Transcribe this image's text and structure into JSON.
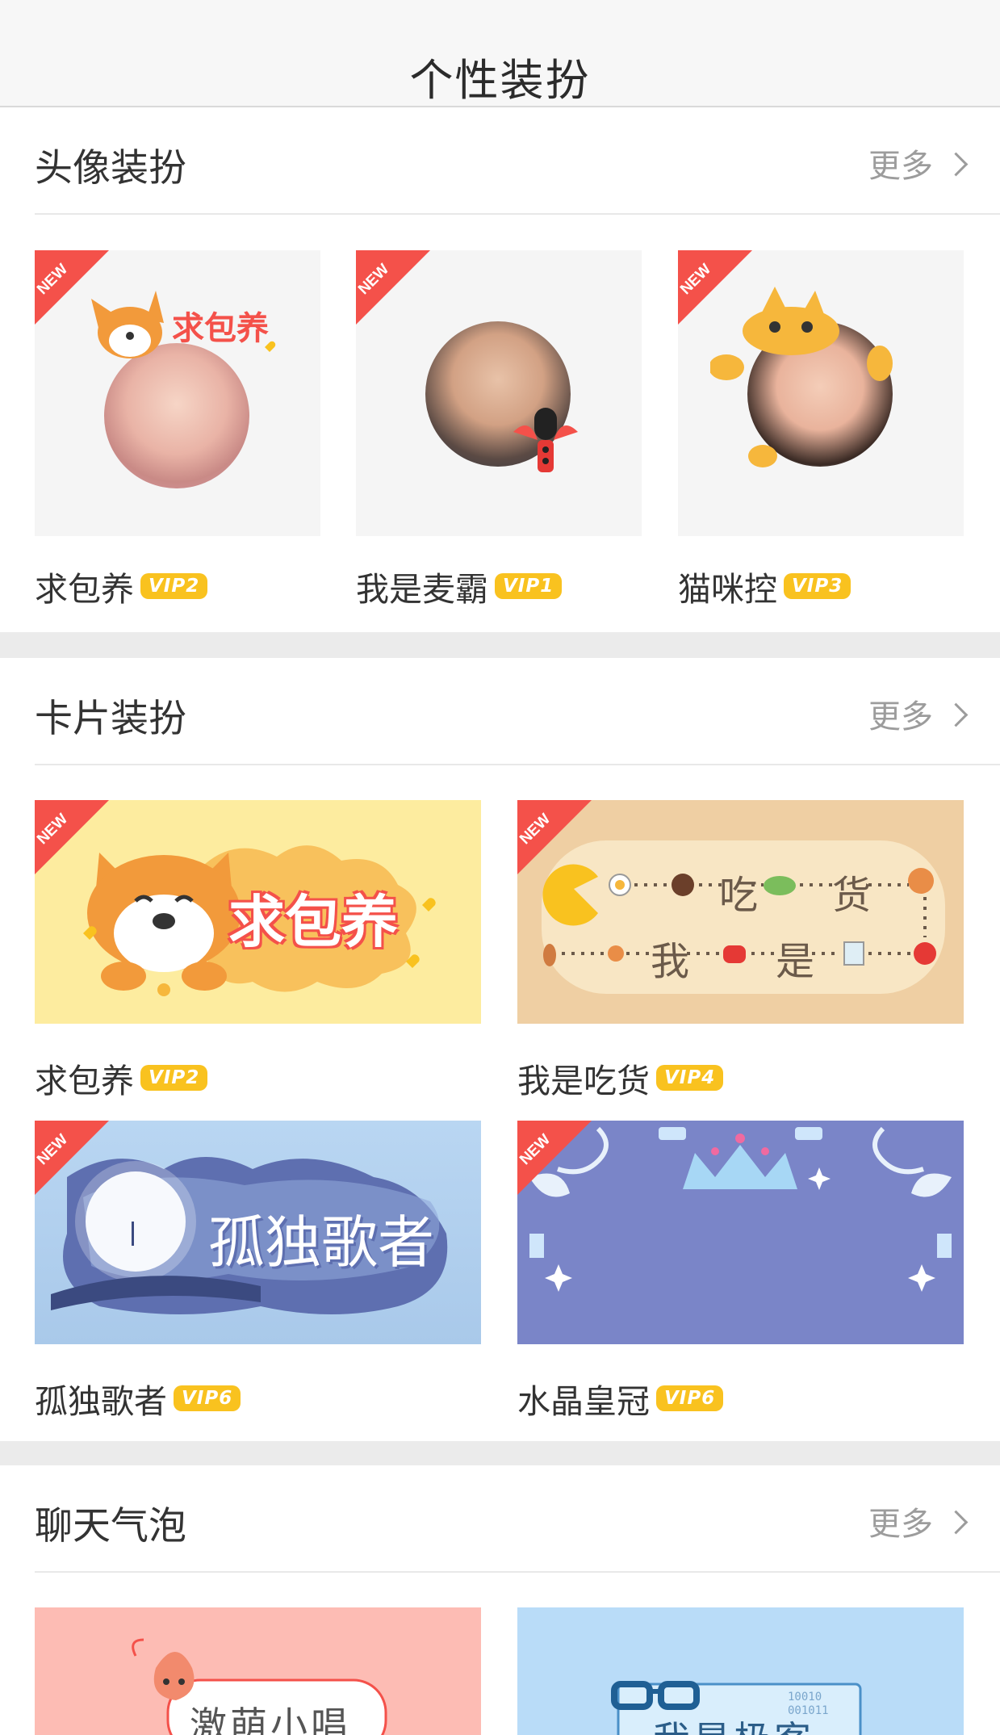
{
  "nav": {
    "title": "个性装扮"
  },
  "more_label": "更多",
  "new_badge": "NEW",
  "colors": {
    "vip": "#f9c21f",
    "new_red": "#f4514a",
    "accent": "#f29a3b"
  },
  "avatar_section": {
    "title": "头像装扮",
    "items": [
      {
        "name": "求包养",
        "vip": "VIP2",
        "overlay_text": "求包养"
      },
      {
        "name": "我是麦霸",
        "vip": "VIP1"
      },
      {
        "name": "猫咪控",
        "vip": "VIP3"
      }
    ]
  },
  "card_section": {
    "title": "卡片装扮",
    "items": [
      {
        "name": "求包养",
        "vip": "VIP2",
        "banner_text": "求包养"
      },
      {
        "name": "我是吃货",
        "vip": "VIP4",
        "banner_words": [
          "吃",
          "货",
          "我",
          "是"
        ]
      },
      {
        "name": "孤独歌者",
        "vip": "VIP6",
        "banner_text": "孤独歌者"
      },
      {
        "name": "水晶皇冠",
        "vip": "VIP6"
      }
    ]
  },
  "bubble_section": {
    "title": "聊天气泡",
    "items": [
      {
        "bubble_text": "激萌小唱"
      },
      {
        "bubble_text": "我是极客"
      }
    ]
  }
}
